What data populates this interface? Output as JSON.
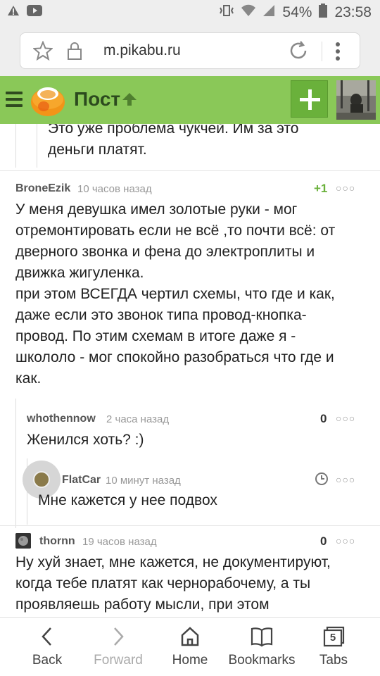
{
  "status_bar": {
    "battery": "54%",
    "time": "23:58"
  },
  "browser": {
    "url": "m.pikabu.ru"
  },
  "header": {
    "title": "Пост"
  },
  "comments": [
    {
      "text_lines": [
        "Это уже проблема чукчей. Им за это",
        "деньги платят."
      ]
    },
    {
      "author": "BroneEzik",
      "time": "10 часов назад",
      "rating": "+1",
      "text_lines": [
        "У меня девушка имел золотые руки - мог",
        "отремонтировать если не всё ,то почти всё: от",
        "дверного звонка и фена до электроплиты и",
        "движка жигуленка.",
        "при этом ВСЕГДА чертил схемы, что где и как,",
        "даже если это звонок типа провод-кнопка-",
        "провод. По этим схемам в итоге даже я -",
        "школоло - мог спокойно разобраться что где и",
        "как."
      ]
    },
    {
      "author": "whothennow",
      "time": "2 часа назад",
      "rating": "0",
      "text_lines": [
        "Женился хоть? :)"
      ]
    },
    {
      "author": "FlatCar",
      "time": "10 минут назад",
      "text_lines": [
        "Мне кажется у нее подвох"
      ]
    },
    {
      "author": "thornn",
      "time": "19 часов назад",
      "rating": "0",
      "text_lines": [
        "Ну хуй знает, мне кажется, не документируют,",
        "когда тебе платят как чернорабочему, а ты",
        "проявляешь работу мысли, при этом"
      ]
    }
  ],
  "bottom_nav": {
    "back": "Back",
    "forward": "Forward",
    "home": "Home",
    "bookmarks": "Bookmarks",
    "tabs": "Tabs",
    "tabs_count": "5"
  },
  "colors": {
    "header_green": "#8ac858",
    "accent_green": "#6ab13b"
  }
}
